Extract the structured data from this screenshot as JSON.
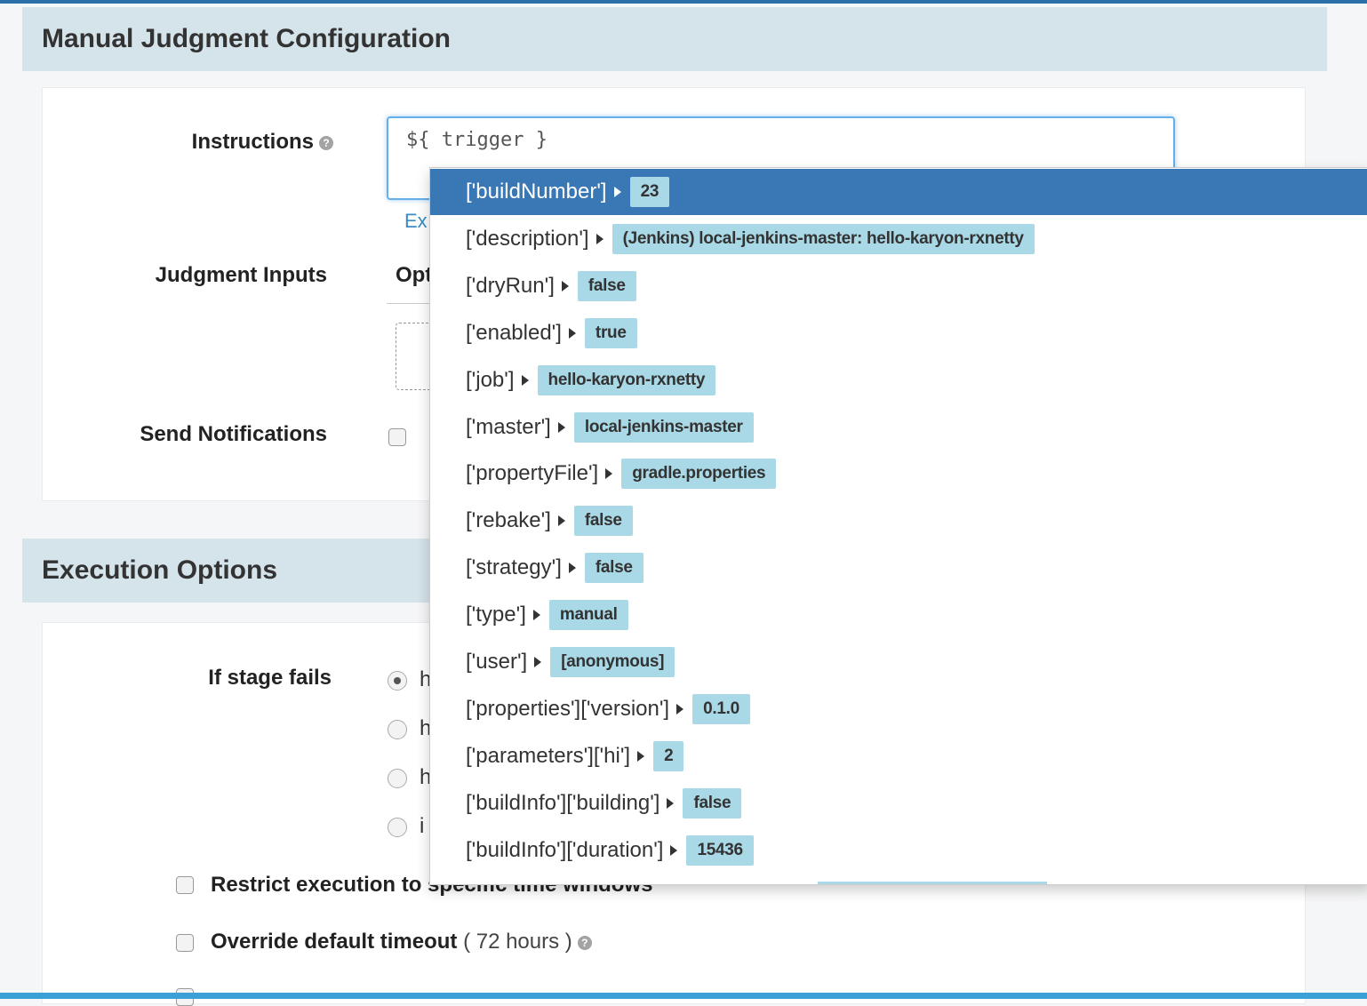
{
  "sections": {
    "manual_judgment": {
      "title": "Manual Judgment Configuration"
    },
    "execution_options": {
      "title": "Execution Options"
    }
  },
  "form": {
    "instructions_label": "Instructions",
    "instructions_value": "${ trigger }",
    "expression_link_partial": "Ex",
    "judgment_inputs_label": "Judgment Inputs",
    "options_header_partial": "Opt",
    "send_notifications_label": "Send Notifications"
  },
  "execution": {
    "if_stage_fails_label": "If stage fails",
    "radio_partials": [
      "h",
      "h",
      "h",
      "i"
    ],
    "restrict_label": "Restrict execution to specific time windows",
    "override_label": "Override default timeout",
    "override_suffix": "( 72 hours )"
  },
  "autocomplete": {
    "items": [
      {
        "key": "['buildNumber']",
        "value": "23",
        "active": true
      },
      {
        "key": "['description']",
        "value": "(Jenkins) local-jenkins-master: hello-karyon-rxnetty"
      },
      {
        "key": "['dryRun']",
        "value": "false"
      },
      {
        "key": "['enabled']",
        "value": "true"
      },
      {
        "key": "['job']",
        "value": "hello-karyon-rxnetty"
      },
      {
        "key": "['master']",
        "value": "local-jenkins-master"
      },
      {
        "key": "['propertyFile']",
        "value": "gradle.properties"
      },
      {
        "key": "['rebake']",
        "value": "false"
      },
      {
        "key": "['strategy']",
        "value": "false"
      },
      {
        "key": "['type']",
        "value": "manual"
      },
      {
        "key": "['user']",
        "value": "[anonymous]"
      },
      {
        "key": "['properties']['version']",
        "value": "0.1.0"
      },
      {
        "key": "['parameters']['hi']",
        "value": "2"
      },
      {
        "key": "['buildInfo']['building']",
        "value": "false"
      },
      {
        "key": "['buildInfo']['duration']",
        "value": "15436"
      }
    ]
  },
  "colors": {
    "header_bg": "#d5e3ea",
    "active_item": "#3a78b5",
    "value_badge": "#a9d8e6",
    "focus_border": "#66afe9"
  }
}
